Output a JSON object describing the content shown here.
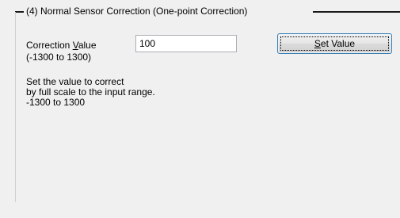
{
  "group": {
    "title": "(4) Normal Sensor Correction (One-point Correction)"
  },
  "correction": {
    "label_prefix": "Correction ",
    "label_mnemonic": "V",
    "label_suffix": "alue",
    "range": "(-1300 to 1300)",
    "value": "100"
  },
  "set_button": {
    "mnemonic": "S",
    "label_rest": "et Value"
  },
  "description": {
    "lines": [
      "Set the value to correct",
      "by full scale to the input range.",
      "-1300 to 1300"
    ]
  },
  "colors": {
    "background": "#f0f0f0",
    "button_border": "#3c7fb1",
    "input_border": "#abadb3"
  }
}
